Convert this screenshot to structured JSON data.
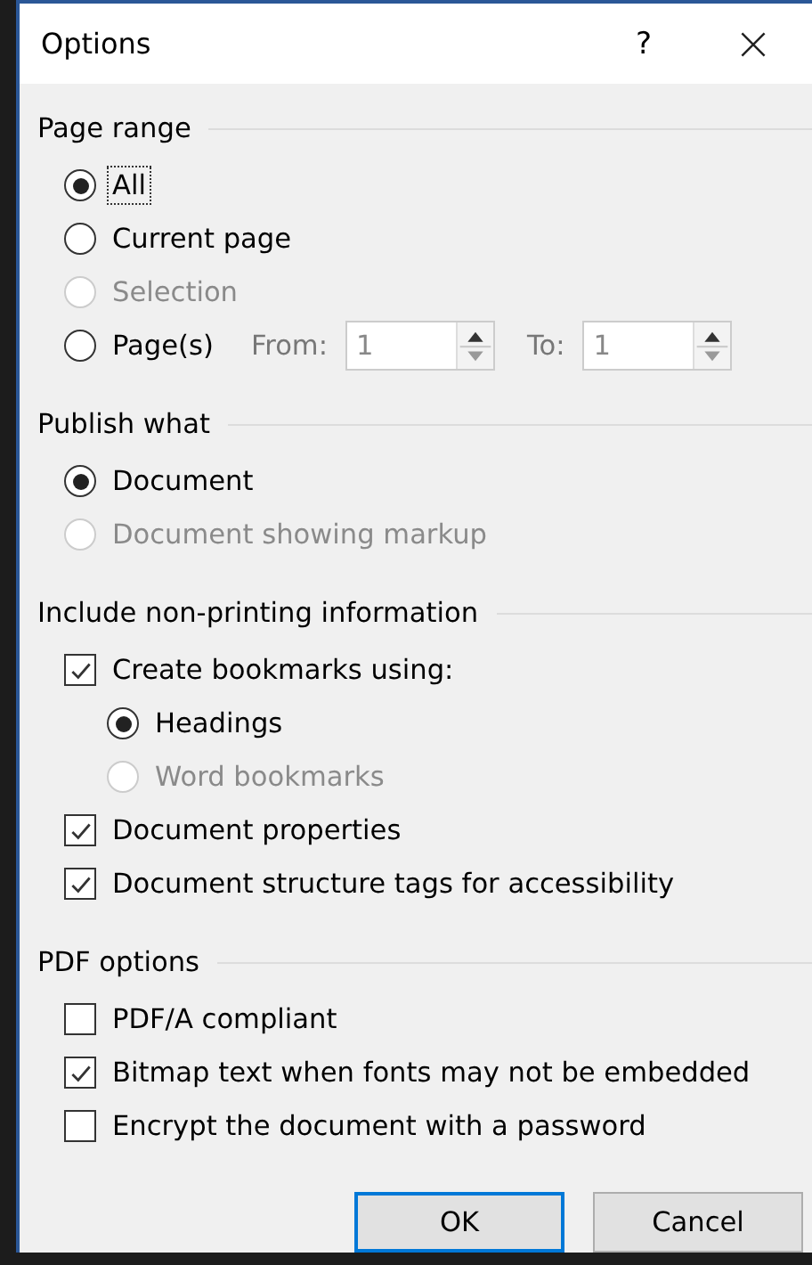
{
  "window": {
    "title": "Options",
    "help": "?"
  },
  "sections": [
    {
      "title": "Page range",
      "items": [
        {
          "kind": "radio",
          "label": "All",
          "selected": true,
          "disabled": false,
          "focused": true
        },
        {
          "kind": "radio",
          "label": "Current page",
          "selected": false,
          "disabled": false,
          "focused": false
        },
        {
          "kind": "radio",
          "label": "Selection",
          "selected": false,
          "disabled": true,
          "focused": false
        },
        {
          "kind": "radio",
          "label": "Page(s)",
          "selected": false,
          "disabled": false,
          "focused": false,
          "range": {
            "disabled": true,
            "fields": [
              {
                "label": "From:",
                "value": "1"
              },
              {
                "label": "To:",
                "value": "1"
              }
            ]
          }
        }
      ]
    },
    {
      "title": "Publish what",
      "items": [
        {
          "kind": "radio",
          "label": "Document",
          "selected": true,
          "disabled": false,
          "focused": false
        },
        {
          "kind": "radio",
          "label": "Document showing markup",
          "selected": false,
          "disabled": true,
          "focused": false
        }
      ]
    },
    {
      "title": "Include non-printing information",
      "items": [
        {
          "kind": "checkbox",
          "label": "Create bookmarks using:",
          "checked": true,
          "disabled": false,
          "focused": false,
          "children": [
            {
              "kind": "radio",
              "label": "Headings",
              "selected": true,
              "disabled": false,
              "focused": false
            },
            {
              "kind": "radio",
              "label": "Word bookmarks",
              "selected": false,
              "disabled": true,
              "focused": false
            }
          ]
        },
        {
          "kind": "checkbox",
          "label": "Document properties",
          "checked": true,
          "disabled": false,
          "focused": false
        },
        {
          "kind": "checkbox",
          "label": "Document structure tags for accessibility",
          "checked": true,
          "disabled": false,
          "focused": false
        }
      ]
    },
    {
      "title": "PDF options",
      "items": [
        {
          "kind": "checkbox",
          "label": "PDF/A compliant",
          "checked": false,
          "disabled": false,
          "focused": false
        },
        {
          "kind": "checkbox",
          "label": "Bitmap text when fonts may not be embedded",
          "checked": true,
          "disabled": false,
          "focused": false
        },
        {
          "kind": "checkbox",
          "label": "Encrypt the document with a password",
          "checked": false,
          "disabled": false,
          "focused": false
        }
      ]
    }
  ],
  "buttons": [
    {
      "label": "OK",
      "default": true
    },
    {
      "label": "Cancel",
      "default": false
    }
  ]
}
